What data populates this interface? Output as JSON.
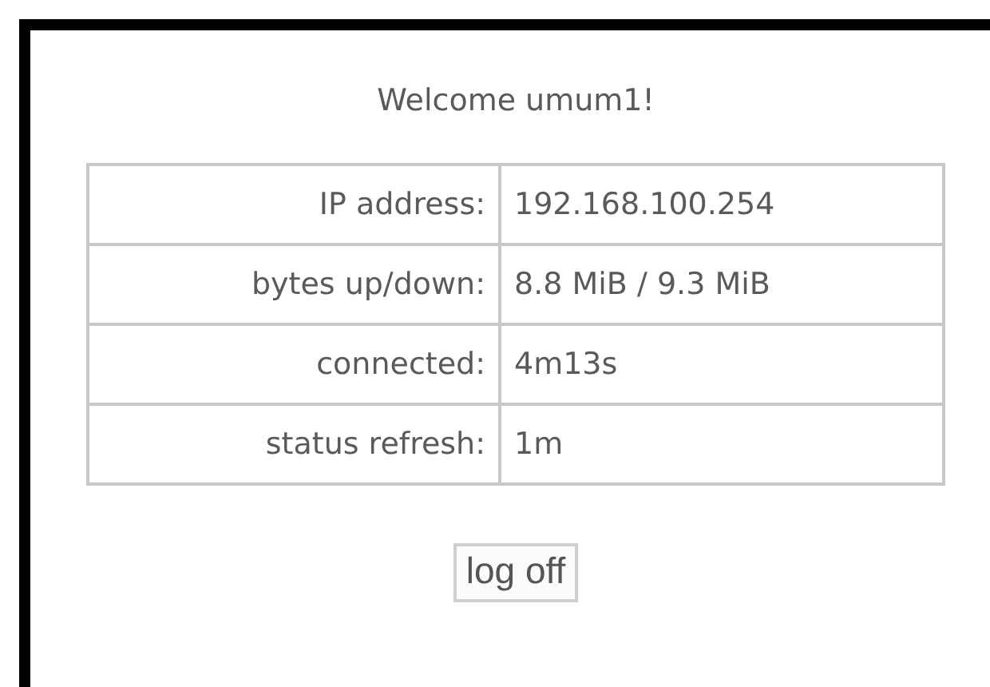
{
  "welcome": "Welcome umum1!",
  "status_table": [
    {
      "label": "IP address:",
      "value": "192.168.100.254"
    },
    {
      "label": "bytes up/down:",
      "value": "8.8 MiB / 9.3 MiB"
    },
    {
      "label": "connected:",
      "value": "4m13s"
    },
    {
      "label": "status refresh:",
      "value": "1m"
    }
  ],
  "buttons": [
    "log off"
  ]
}
